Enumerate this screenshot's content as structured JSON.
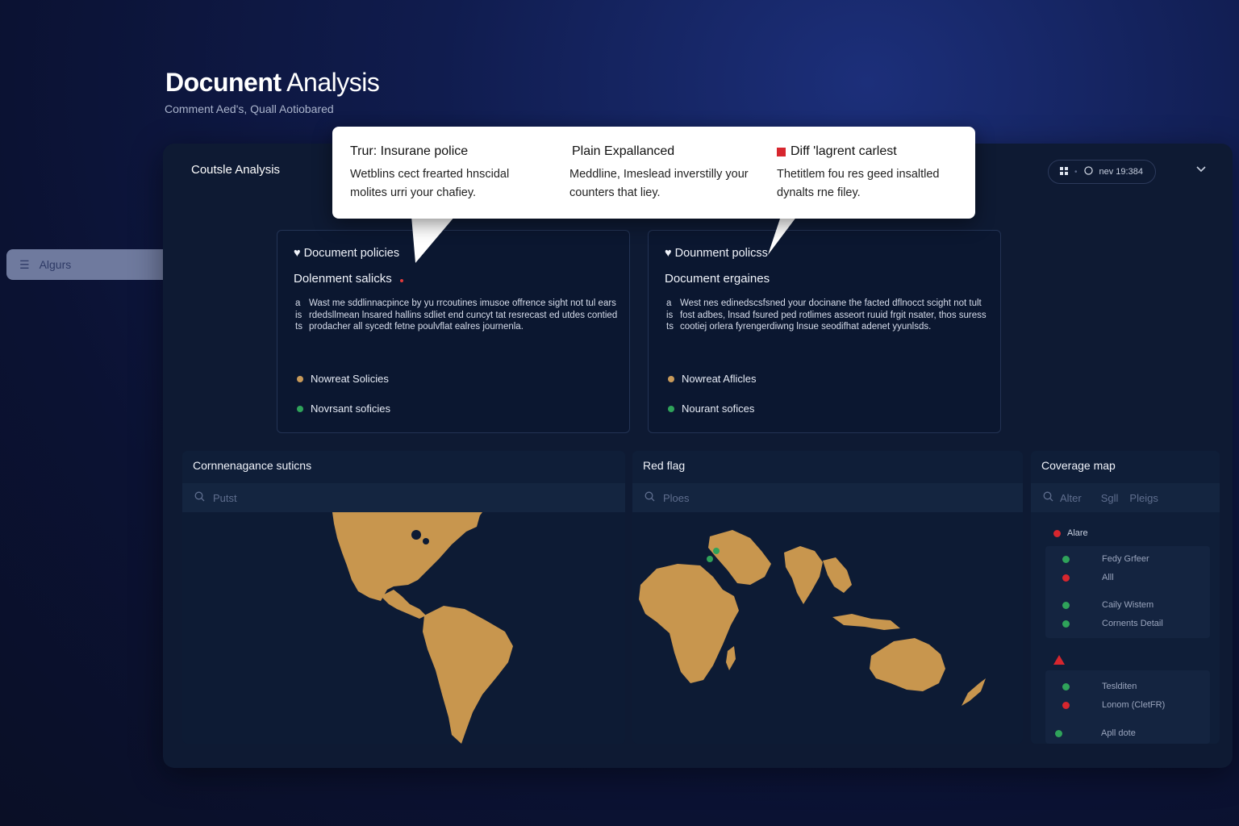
{
  "header": {
    "title_bold": "Docunent",
    "title_light": "Analysis",
    "subtitle": "Comment Aed's, Quall Aotiobared"
  },
  "sidebar": {
    "item_label": "Algurs",
    "item_icon": "list-icon"
  },
  "panel": {
    "title": "Coutsle Analysis",
    "control_time": "nev 19:384",
    "control_icon": "grid-icon"
  },
  "tooltip": {
    "columns": [
      {
        "heading": "Trur: Insurane police",
        "text": "Wetblins cect frearted hnscidal molites urri your chafiey."
      },
      {
        "heading": "Plain Expallanced",
        "text": "Meddline, Imeslead inverstilly your counters that liey."
      },
      {
        "heading": "Diff 'lagrent carlest",
        "text": "Thetitlem fou res geed insaltled dynalts rne filey.",
        "marker_color": "#d7262e"
      }
    ]
  },
  "cards": [
    {
      "title": "Document policies",
      "subtitle": "Dolenment salicks",
      "markers": [
        "a",
        "is",
        "ts"
      ],
      "paragraph": "Wast me sddlinnacpince by yu rrcoutines imusoe offrence sight not tul ears rdedsllmean lnsared hallins sdliet end cuncyt tat resrecast ed utdes contied prodacher all sycedt fetne poulvflat ealres journenla.",
      "legend": [
        {
          "label": "Nowreat Solicies",
          "color": "#c89a5a"
        },
        {
          "label": "Novrsant soficies",
          "color": "#2fa35a"
        }
      ]
    },
    {
      "title": "Dounment policss",
      "subtitle": "Document ergaines",
      "markers": [
        "a",
        "is",
        "ts"
      ],
      "paragraph": "West nes edinedscsfsned your docinane the facted dflnocct scight not tult fost adbes, lnsad fsured ped rotlimes asseort ruuid frgit nsater, thos suress cootiej orlera fyrengerdiwng lnsue seodifhat adenet yyunlsds.",
      "legend": [
        {
          "label": "Nowreat Aflicles",
          "color": "#c89a5a"
        },
        {
          "label": "Nourant sofices",
          "color": "#2fa35a"
        }
      ]
    }
  ],
  "maps": [
    {
      "title": "Cornnenagance suticns",
      "search_placeholder": "Putst"
    },
    {
      "title": "Red flag",
      "search_placeholder": "Ploes"
    }
  ],
  "coverage": {
    "title": "Coverage map",
    "search_items": [
      "Alter",
      "Sgll",
      "Pleigs"
    ],
    "legend_label": "Alare",
    "group1": [
      {
        "label": "Fedy Grfeer",
        "color": "#2fa35a"
      },
      {
        "label": "Alll",
        "color": "#d7262e"
      },
      {
        "label": "Caily Wistem",
        "color": "#2fa35a"
      },
      {
        "label": "Cornents Detail",
        "color": "#2fa35a"
      }
    ],
    "group2": [
      {
        "label": "Teslditen",
        "color": "#2fa35a"
      },
      {
        "label": "Lonom (CletFR)",
        "color": "#d7262e"
      },
      {
        "label": "Apll dote",
        "color": "#2fa35a"
      }
    ]
  },
  "colors": {
    "land": "#c8964e",
    "accent_red": "#d7262e",
    "accent_green": "#2fa35a",
    "panel_bg": "#0e1a33"
  }
}
